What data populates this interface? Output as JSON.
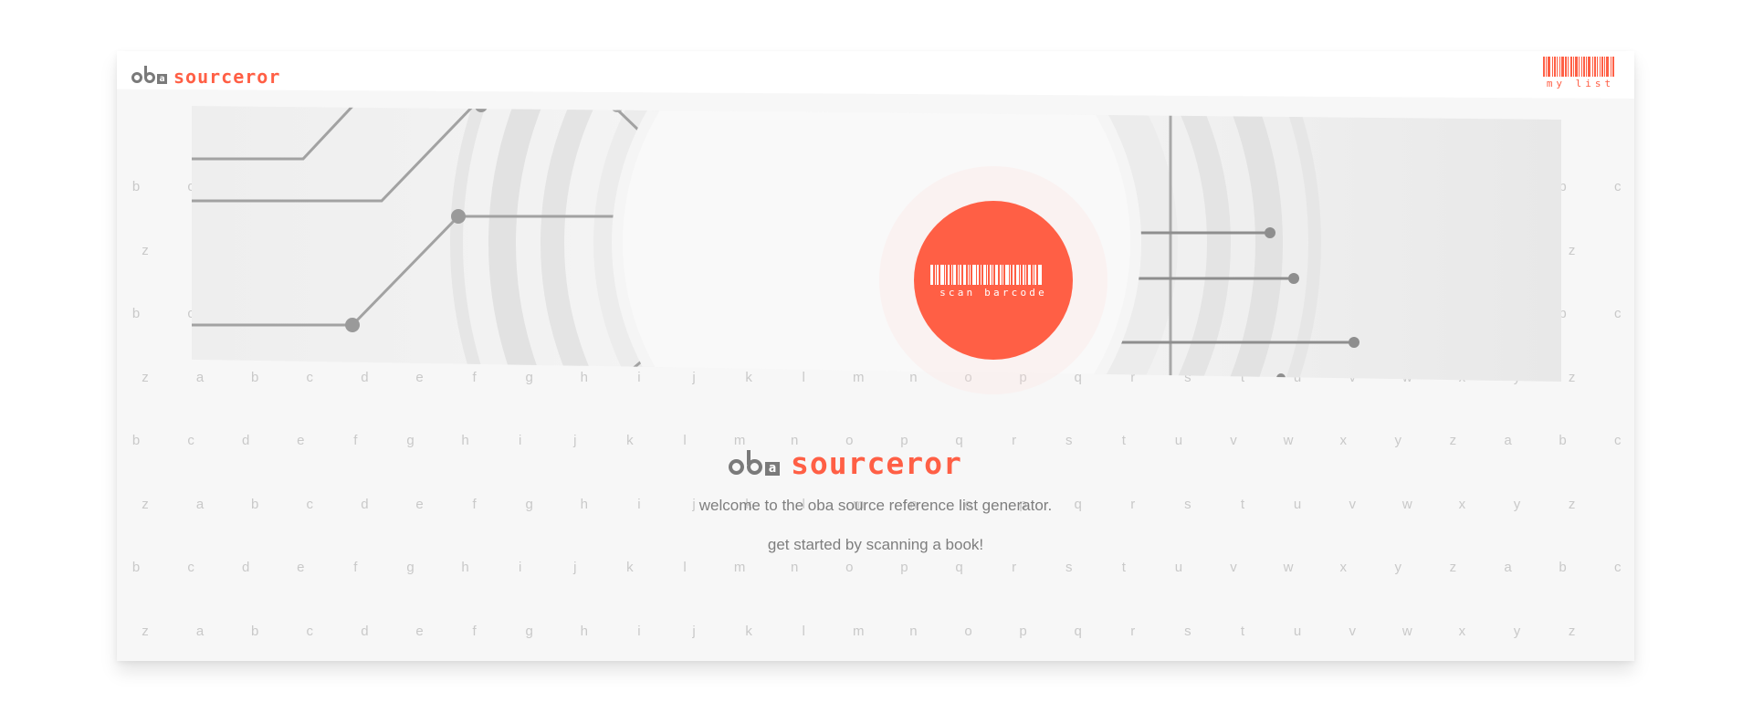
{
  "header": {
    "logo": {
      "mark": "oba",
      "name": "sourceror"
    },
    "my_list_label": "my list",
    "my_list_icon": "barcode-icon"
  },
  "hero": {
    "scan_label": "scan barcode",
    "scan_icon": "barcode-icon"
  },
  "main": {
    "logo": {
      "mark": "oba",
      "name": "sourceror"
    },
    "welcome_text": "welcome to the oba source reference list generator.",
    "cta_text": "get started by scanning a book!"
  },
  "background_letters": {
    "row_a": [
      "b",
      "c",
      "d",
      "e",
      "f",
      "g",
      "h",
      "i",
      "j",
      "k",
      "l",
      "m",
      "n",
      "o",
      "p",
      "q",
      "r",
      "s",
      "t",
      "u",
      "v",
      "w",
      "x",
      "y",
      "z",
      "a",
      "b",
      "c"
    ],
    "row_b": [
      "z",
      "a",
      "b",
      "c",
      "d",
      "e",
      "f",
      "g",
      "h",
      "i",
      "j",
      "k",
      "l",
      "m",
      "n",
      "o",
      "p",
      "q",
      "r",
      "s",
      "t",
      "u",
      "v",
      "w",
      "x",
      "y",
      "z"
    ]
  },
  "colors": {
    "accent": "#ff5f45",
    "logo_gray": "#7a7a7a",
    "text_gray": "#7e7e7e",
    "letter_gray": "#c9c9c9"
  }
}
